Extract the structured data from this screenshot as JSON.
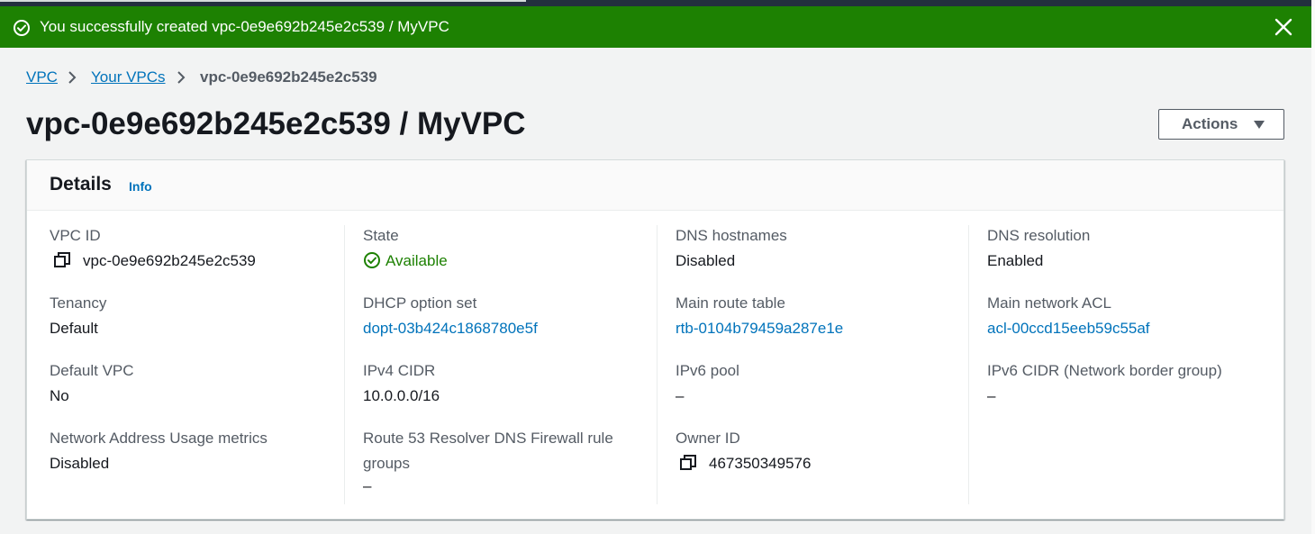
{
  "flash": {
    "message": "You successfully created vpc-0e9e692b245e2c539 / MyVPC",
    "status_color": "#1d8102",
    "icon": "check-circle-icon",
    "close_icon": "close-icon"
  },
  "breadcrumb": {
    "items": [
      "VPC",
      "Your VPCs"
    ],
    "current": "vpc-0e9e692b245e2c539"
  },
  "page": {
    "title": "vpc-0e9e692b245e2c539 / MyVPC"
  },
  "actions": {
    "label": "Actions"
  },
  "details": {
    "title": "Details",
    "info_label": "Info",
    "fields": {
      "vpc_id": {
        "label": "VPC ID",
        "value": "vpc-0e9e692b245e2c539"
      },
      "state": {
        "label": "State",
        "value": "Available"
      },
      "dns_hostnames": {
        "label": "DNS hostnames",
        "value": "Disabled"
      },
      "dns_resolution": {
        "label": "DNS resolution",
        "value": "Enabled"
      },
      "tenancy": {
        "label": "Tenancy",
        "value": "Default"
      },
      "dhcp_option_set": {
        "label": "DHCP option set",
        "value": "dopt-03b424c1868780e5f"
      },
      "main_route_table": {
        "label": "Main route table",
        "value": "rtb-0104b79459a287e1e"
      },
      "main_network_acl": {
        "label": "Main network ACL",
        "value": "acl-00ccd15eeb59c55af"
      },
      "default_vpc": {
        "label": "Default VPC",
        "value": "No"
      },
      "ipv4_cidr": {
        "label": "IPv4 CIDR",
        "value": "10.0.0.0/16"
      },
      "ipv6_pool": {
        "label": "IPv6 pool",
        "value": "–"
      },
      "ipv6_cidr": {
        "label": "IPv6 CIDR (Network border group)",
        "value": "–"
      },
      "nau_metrics": {
        "label": "Network Address Usage metrics",
        "value": "Disabled"
      },
      "route53_groups": {
        "label": "Route 53 Resolver DNS Firewall rule groups",
        "value": "–"
      },
      "owner_id": {
        "label": "Owner ID",
        "value": "467350349576"
      }
    }
  },
  "colors": {
    "link": "#0073bb",
    "success": "#1d8102",
    "text": "#16191f",
    "label": "#545b64"
  }
}
